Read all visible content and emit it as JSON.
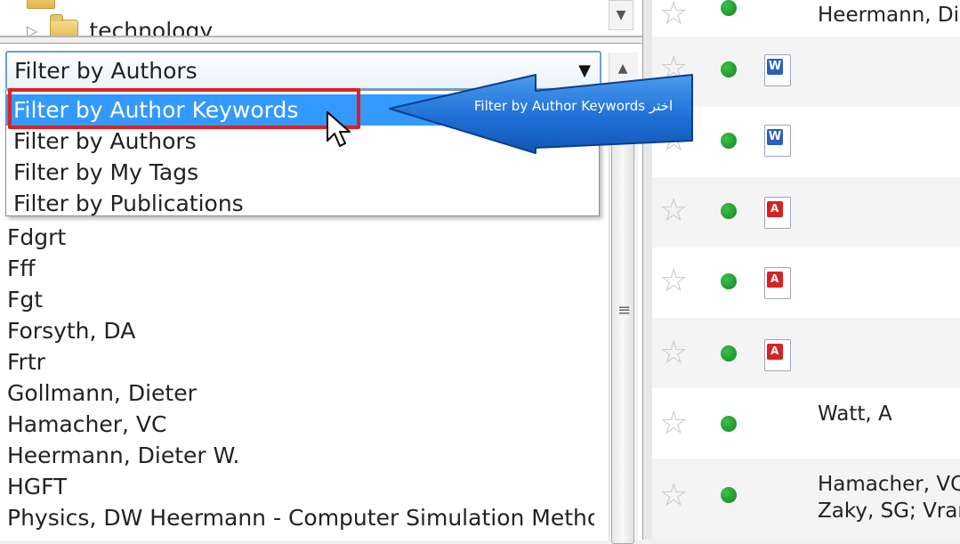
{
  "folder_tree": {
    "visible_item": "technology"
  },
  "filter": {
    "combo_value": "Filter by Authors",
    "options": [
      "Filter by Author Keywords",
      "Filter by Authors",
      "Filter by My Tags",
      "Filter by Publications"
    ],
    "selected_index": 0
  },
  "authors": [
    "Fdgrt",
    "Fff",
    "Fgt",
    "Forsyth, DA",
    "Frtr",
    "Gollmann, Dieter",
    "Hamacher, VC",
    "Heermann, Dieter W.",
    "HGFT",
    "Physics, DW Heermann - Computer Simulation Methods i..."
  ],
  "documents": [
    {
      "file_type": "none",
      "authors_line1": "Heermann, Die",
      "authors_line2": ""
    },
    {
      "file_type": "word-icon",
      "authors_line1": "",
      "authors_line2": ""
    },
    {
      "file_type": "word-icon",
      "authors_line1": "",
      "authors_line2": ""
    },
    {
      "file_type": "pdf-icon",
      "authors_line1": "",
      "authors_line2": ""
    },
    {
      "file_type": "pdf-icon",
      "authors_line1": "",
      "authors_line2": ""
    },
    {
      "file_type": "pdf-icon",
      "authors_line1": "",
      "authors_line2": ""
    },
    {
      "file_type": "none",
      "authors_line1": "Watt, A",
      "authors_line2": ""
    },
    {
      "file_type": "none",
      "authors_line1": "Hamacher, VC",
      "authors_line2": "Zaky, SG; Vran"
    }
  ],
  "annotation": {
    "callout_text": "Filter by Author Keywords  اختر",
    "callout_color": "#1f6fd6",
    "highlight_color": "#e02020"
  },
  "colors": {
    "selection": "#3399ff",
    "read_status": "#1fa22e"
  }
}
